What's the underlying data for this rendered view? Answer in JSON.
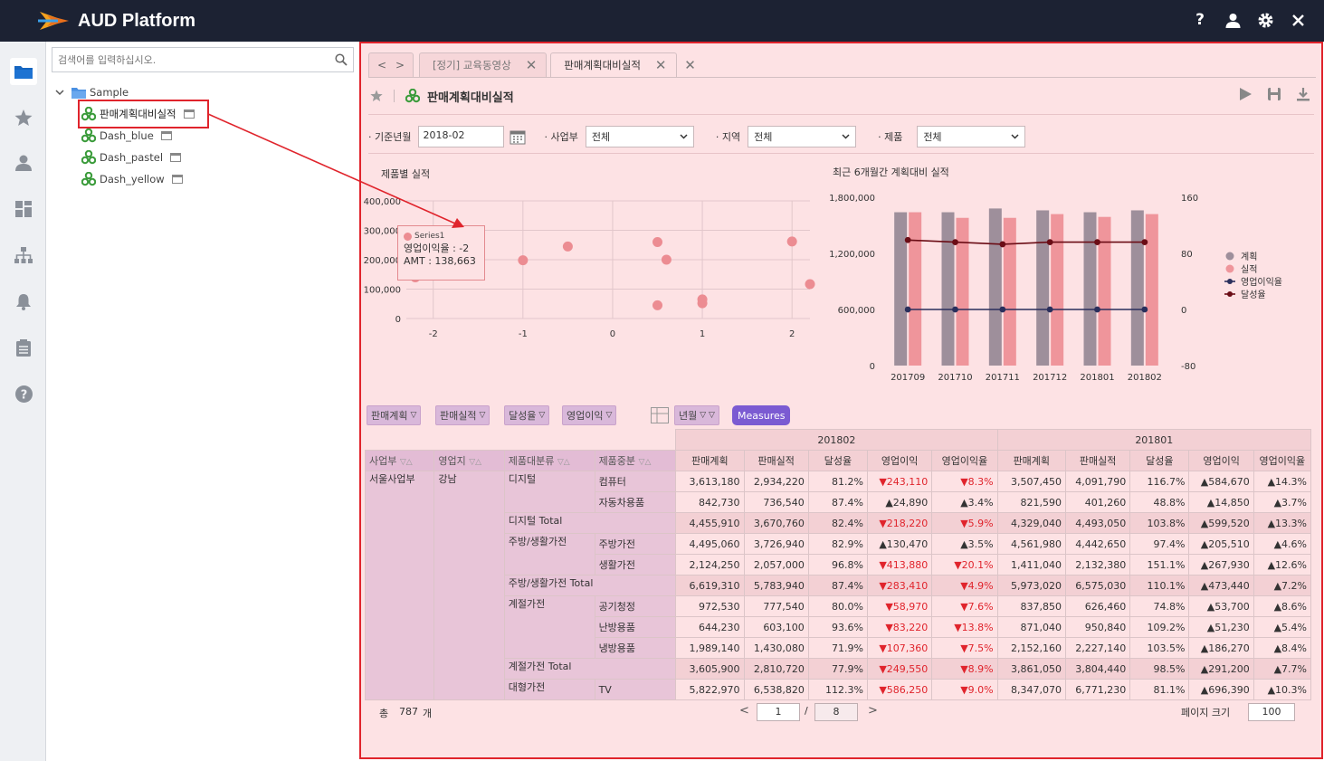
{
  "app": {
    "title": "AUD Platform"
  },
  "top_icons": [
    "help-icon",
    "user-icon",
    "gear-icon",
    "close-icon"
  ],
  "sidebar_icons": [
    "folder-icon",
    "star-icon",
    "user-icon",
    "dashboard-icon",
    "org-chart-icon",
    "bell-icon",
    "clipboard-icon",
    "help-icon"
  ],
  "tree": {
    "search_placeholder": "검색어를 입력하십시오.",
    "root": "Sample",
    "items": [
      "판매계획대비실적",
      "Dash_blue",
      "Dash_pastel",
      "Dash_yellow"
    ]
  },
  "tabs": [
    {
      "label": "[정기] 교육동영상"
    },
    {
      "label": "판매계획대비실적"
    }
  ],
  "report": {
    "title": "판매계획대비실적"
  },
  "filters": {
    "period_label": "· 기준년월",
    "period_value": "2018-02",
    "division_label": "· 사업부",
    "division_value": "전체",
    "region_label": "· 지역",
    "region_value": "전체",
    "product_label": "· 제품",
    "product_value": "전체"
  },
  "chart_data": [
    {
      "type": "scatter",
      "title": "제품별 실적",
      "xlim": [
        -2.3,
        2.2
      ],
      "ylim": [
        0,
        400000
      ],
      "x_ticks": [
        "-2",
        "-1",
        "0",
        "1",
        "2"
      ],
      "y_ticks": [
        "0",
        "100,000",
        "200,000",
        "300,000",
        "400,000"
      ],
      "series": [
        {
          "name": "Series1",
          "points": [
            [
              -2.2,
              140000
            ],
            [
              -2,
              300000
            ],
            [
              -1,
              198000
            ],
            [
              -0.5,
              245000
            ],
            [
              0.5,
              260000
            ],
            [
              0.6,
              200000
            ],
            [
              0.5,
              45000
            ],
            [
              1,
              65000
            ],
            [
              1,
              52000
            ],
            [
              2,
              262000
            ],
            [
              2.2,
              117000
            ]
          ]
        }
      ],
      "tooltip": {
        "series": "Series1",
        "line1": "영업이익율 : -2",
        "line2": "AMT : 138,663"
      }
    },
    {
      "type": "bar",
      "title": "최근 6개월간 계획대비 실적",
      "categories": [
        "201709",
        "201710",
        "201711",
        "201712",
        "201801",
        "201802"
      ],
      "ylim": [
        0,
        1800000
      ],
      "y2lim": [
        -80,
        160
      ],
      "y_ticks": [
        "0",
        "600,000",
        "1,200,000",
        "1,800,000"
      ],
      "y2_ticks": [
        "-80",
        "0",
        "80",
        "160"
      ],
      "series": [
        {
          "name": "계획",
          "axis": "left",
          "values": [
            1640000,
            1640000,
            1680000,
            1660000,
            1640000,
            1660000
          ]
        },
        {
          "name": "실적",
          "axis": "left",
          "values": [
            1640000,
            1580000,
            1580000,
            1620000,
            1590000,
            1620000
          ]
        },
        {
          "name": "영업이익율",
          "axis": "right",
          "values": [
            0,
            0,
            0,
            0,
            0,
            0
          ]
        },
        {
          "name": "달성율",
          "axis": "right",
          "values": [
            99,
            96,
            93,
            96,
            96,
            96
          ]
        }
      ]
    }
  ],
  "pivot": {
    "filter_fields": [
      "판매계획",
      "판매실적",
      "달성율",
      "영업이익"
    ],
    "col_field": "년월",
    "measures_label": "Measures",
    "row_fields": [
      "사업부",
      "영업지",
      "제품대분류",
      "제품중분"
    ],
    "periods": [
      "201802",
      "201801"
    ],
    "measures": [
      "판매계획",
      "판매실적",
      "달성율",
      "영업이익",
      "영업이익율"
    ],
    "rows": [
      {
        "c1": "서울사업부",
        "c2": "강남",
        "c3": "디지털",
        "c4": "컴퓨터",
        "v": [
          "3,613,180",
          "2,934,220",
          "81.2%",
          "▼243,110",
          "▼8.3%",
          "3,507,450",
          "4,091,790",
          "116.7%",
          "▲584,670",
          "▲14.3%"
        ]
      },
      {
        "c1": "",
        "c2": "",
        "c3": "",
        "c4": "자동차용품",
        "v": [
          "842,730",
          "736,540",
          "87.4%",
          "▲24,890",
          "▲3.4%",
          "821,590",
          "401,260",
          "48.8%",
          "▲14,850",
          "▲3.7%"
        ]
      },
      {
        "c1": "",
        "c2": "",
        "c3": "디지털 Total",
        "c4": "",
        "tot": true,
        "v": [
          "4,455,910",
          "3,670,760",
          "82.4%",
          "▼218,220",
          "▼5.9%",
          "4,329,040",
          "4,493,050",
          "103.8%",
          "▲599,520",
          "▲13.3%"
        ]
      },
      {
        "c1": "",
        "c2": "",
        "c3": "주방/생활가전",
        "c4": "주방가전",
        "v": [
          "4,495,060",
          "3,726,940",
          "82.9%",
          "▲130,470",
          "▲3.5%",
          "4,561,980",
          "4,442,650",
          "97.4%",
          "▲205,510",
          "▲4.6%"
        ]
      },
      {
        "c1": "",
        "c2": "",
        "c3": "",
        "c4": "생활가전",
        "v": [
          "2,124,250",
          "2,057,000",
          "96.8%",
          "▼413,880",
          "▼20.1%",
          "1,411,040",
          "2,132,380",
          "151.1%",
          "▲267,930",
          "▲12.6%"
        ]
      },
      {
        "c1": "",
        "c2": "",
        "c3": "주방/생활가전 Total",
        "c4": "",
        "tot": true,
        "v": [
          "6,619,310",
          "5,783,940",
          "87.4%",
          "▼283,410",
          "▼4.9%",
          "5,973,020",
          "6,575,030",
          "110.1%",
          "▲473,440",
          "▲7.2%"
        ]
      },
      {
        "c1": "",
        "c2": "",
        "c3": "계절가전",
        "c4": "공기청정",
        "v": [
          "972,530",
          "777,540",
          "80.0%",
          "▼58,970",
          "▼7.6%",
          "837,850",
          "626,460",
          "74.8%",
          "▲53,700",
          "▲8.6%"
        ]
      },
      {
        "c1": "",
        "c2": "",
        "c3": "",
        "c4": "난방용품",
        "v": [
          "644,230",
          "603,100",
          "93.6%",
          "▼83,220",
          "▼13.8%",
          "871,040",
          "950,840",
          "109.2%",
          "▲51,230",
          "▲5.4%"
        ]
      },
      {
        "c1": "",
        "c2": "",
        "c3": "",
        "c4": "냉방용품",
        "v": [
          "1,989,140",
          "1,430,080",
          "71.9%",
          "▼107,360",
          "▼7.5%",
          "2,152,160",
          "2,227,140",
          "103.5%",
          "▲186,270",
          "▲8.4%"
        ]
      },
      {
        "c1": "",
        "c2": "",
        "c3": "계절가전 Total",
        "c4": "",
        "tot": true,
        "v": [
          "3,605,900",
          "2,810,720",
          "77.9%",
          "▼249,550",
          "▼8.9%",
          "3,861,050",
          "3,804,440",
          "98.5%",
          "▲291,200",
          "▲7.7%"
        ]
      },
      {
        "c1": "",
        "c2": "",
        "c3": "대형가전",
        "c4": "TV",
        "v": [
          "5,822,970",
          "6,538,820",
          "112.3%",
          "▼586,250",
          "▼9.0%",
          "8,347,070",
          "6,771,230",
          "81.1%",
          "▲696,390",
          "▲10.3%"
        ]
      }
    ]
  },
  "footer": {
    "total_prefix": "총",
    "total_count": "787",
    "total_suffix": "개",
    "page": "1",
    "page_sep": "/",
    "page_total": "8",
    "page_size_label": "페이지 크기",
    "page_size": "100"
  }
}
